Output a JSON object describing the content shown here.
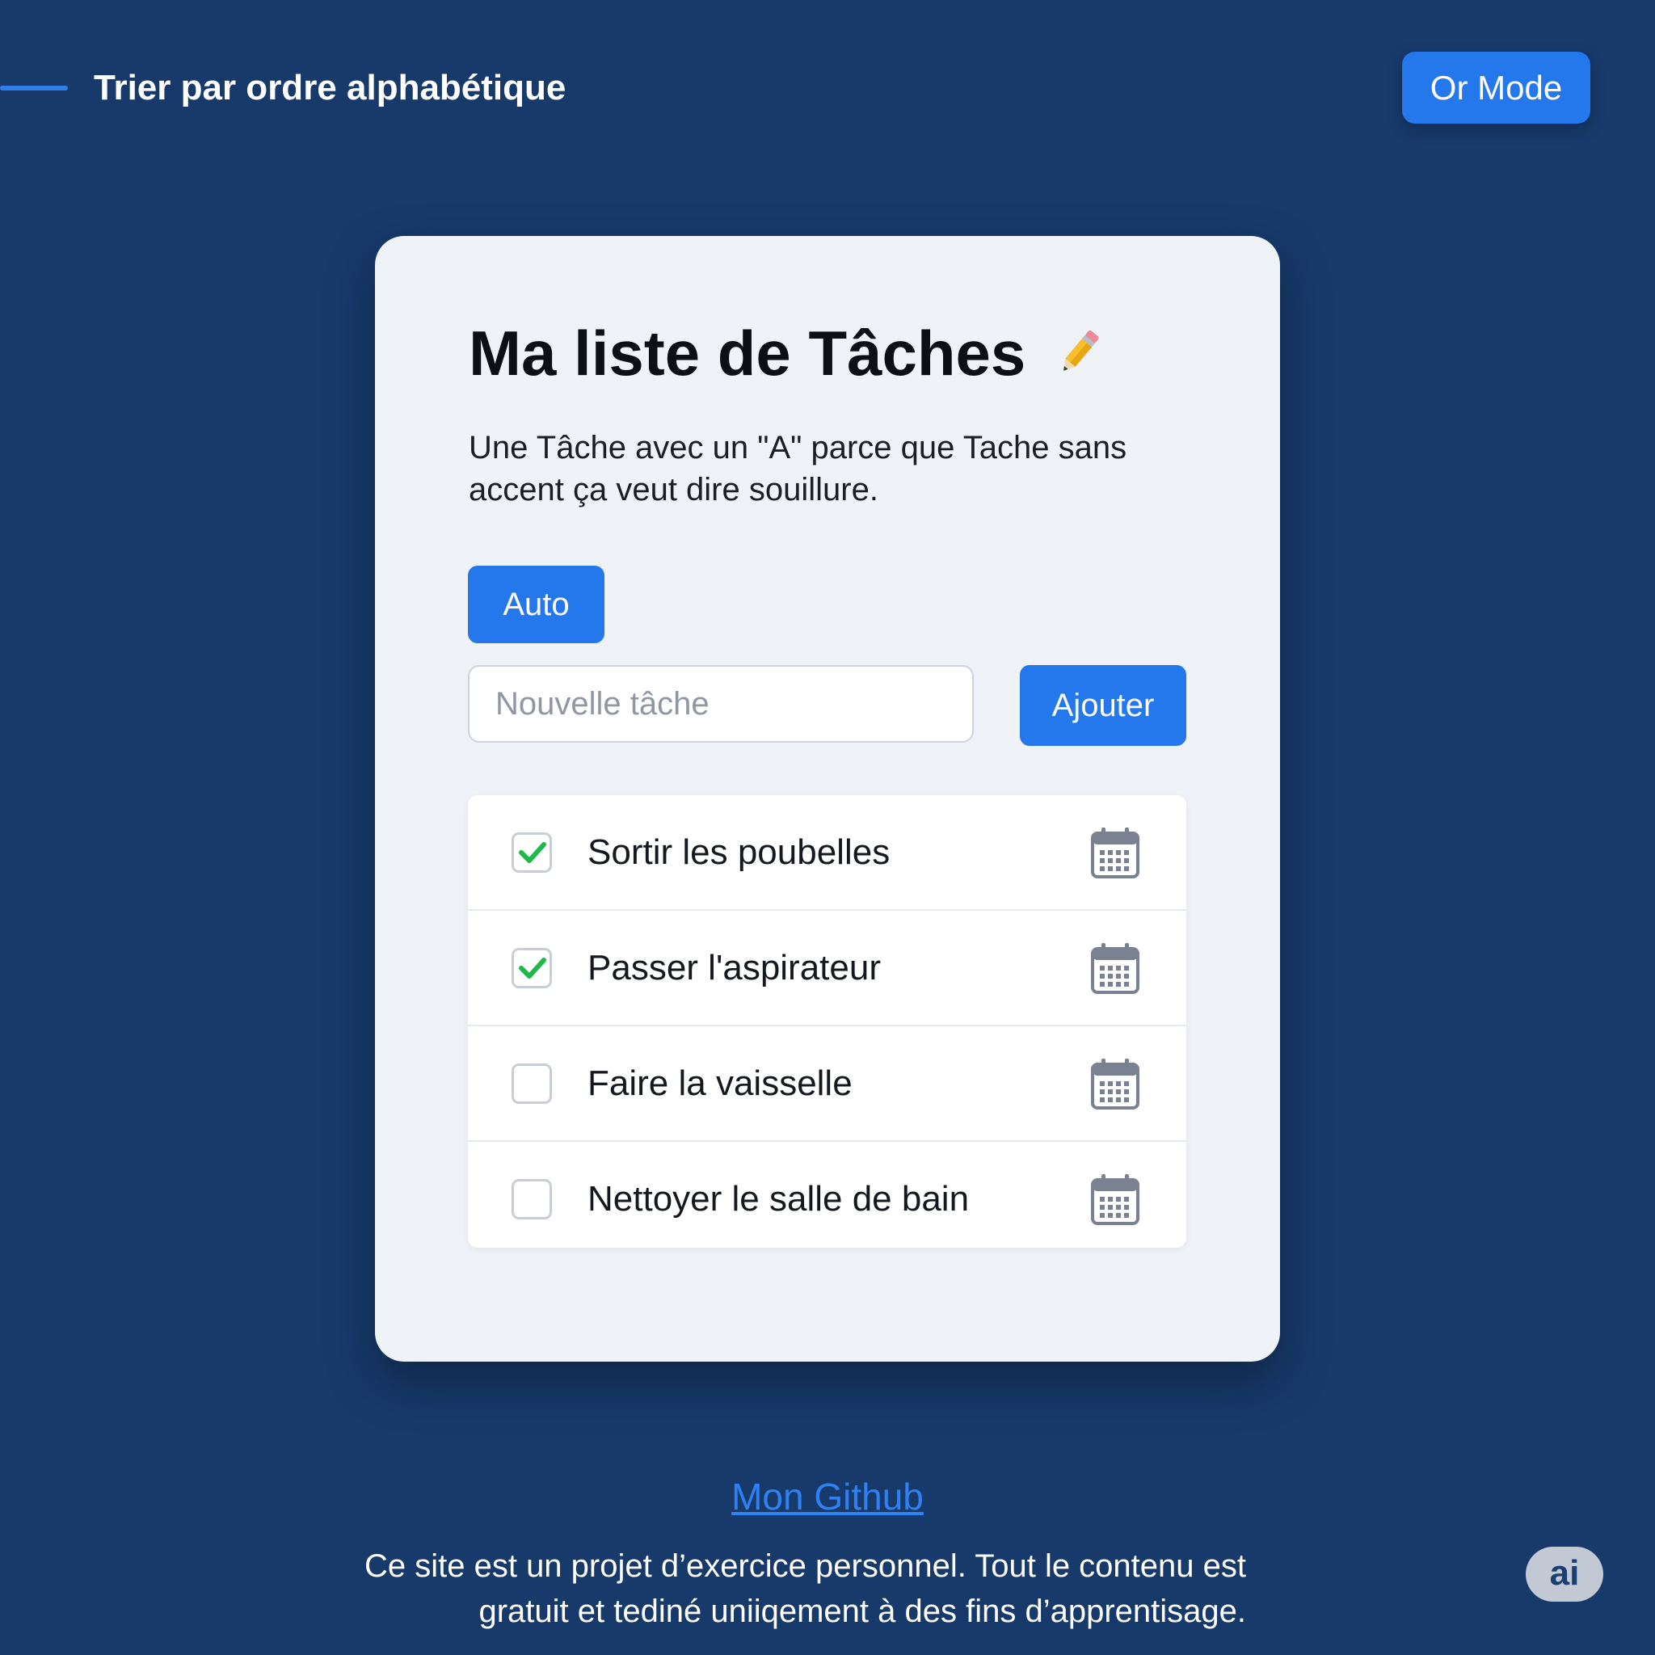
{
  "header": {
    "sort_label": "Trier par ordre alphabétique",
    "mode_button": "Or Mode"
  },
  "card": {
    "title": "Ma liste de Tâches",
    "title_icon": "pencil-icon",
    "subtitle": "Une Tâche avec un \"A\" parce que Tache sans accent ça veut dire souillure.",
    "auto_button": "Auto",
    "input_placeholder": "Nouvelle tâche",
    "input_value": "",
    "add_button": "Ajouter"
  },
  "tasks": [
    {
      "label": "Sortir les poubelles",
      "done": true,
      "icon": "calendar-icon"
    },
    {
      "label": "Passer l'aspirateur",
      "done": true,
      "icon": "calendar-icon"
    },
    {
      "label": "Faire la vaisselle",
      "done": false,
      "icon": "calendar-icon"
    },
    {
      "label": "Nettoyer le salle de bain",
      "done": false,
      "icon": "calendar-icon"
    }
  ],
  "footer": {
    "github_link": "Mon Github",
    "note": "Ce site est un projet d’exercice personnel. Tout le contenu est gratuit et tediné uniiqement à des fins d’apprentisage.",
    "badge": "ai"
  },
  "colors": {
    "background": "#173a6b",
    "accent": "#2478ec",
    "check": "#1fb84a",
    "link": "#2f80f0"
  }
}
